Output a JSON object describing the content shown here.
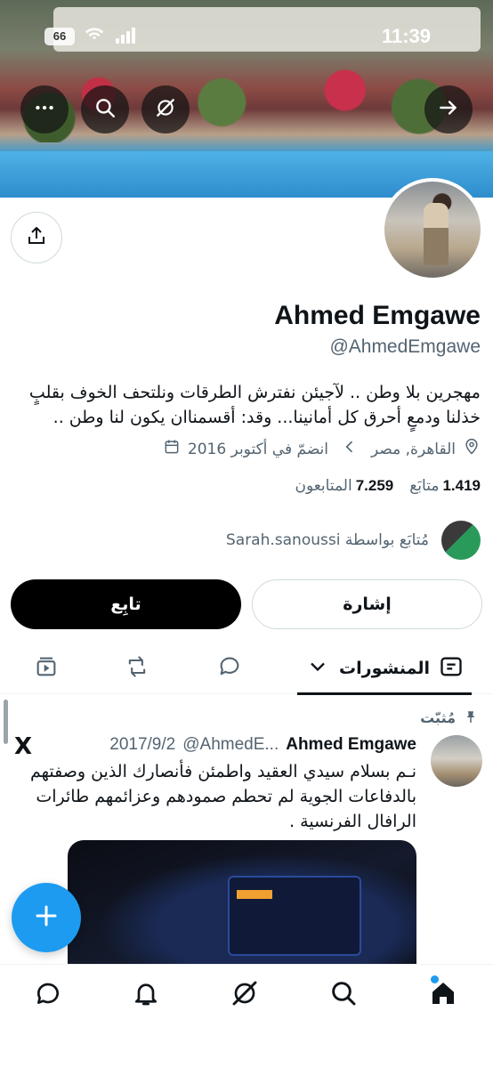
{
  "status_bar": {
    "time": "11:39",
    "battery": "66"
  },
  "profile": {
    "name": "Ahmed Emgawe",
    "handle": "@AhmedEmgawe",
    "bio": "مهجرين بلا وطن .. لآجيئن نفترش الطرقات ونلتحف الخوف بقلبٍ خذلنا ودمعٍ أحرق كل أمانينا... وقد: أقسمناان يكون لنا وطن ..",
    "location": "القاهرة, مصر",
    "joined": "انضمّ في أكتوبر 2016",
    "following_count": "1.419",
    "following_label": "متابَع",
    "followers_count": "7.259",
    "followers_label": "المتابعون",
    "followed_by": "مُتابَع بواسطة Sarah.sanoussi"
  },
  "actions": {
    "follow_label": "تابِع",
    "mention_label": "إشارة"
  },
  "tabs": {
    "posts_label": "المنشورات"
  },
  "post": {
    "pinned_label": "مُثبّت",
    "author_name": "Ahmed Emgawe",
    "author_meta": "@AhmedE...",
    "date": "2017/9/2",
    "text": "نـم بسلام سيدي العقيد واطمئن فأنصارك الذين وصفتهم بالدفاعات الجوية لم تحطم صمودهم وعزائمهم طائرات الرافال الفرنسية ."
  },
  "icons": {
    "more": "more-icon",
    "search": "search-icon",
    "grok": "grok-icon",
    "forward": "arrow-right-icon",
    "share": "share-icon",
    "location": "location-icon",
    "calendar": "calendar-icon",
    "chevron": "chevron-left-icon",
    "x_logo": "X",
    "fab": "plus-icon"
  }
}
